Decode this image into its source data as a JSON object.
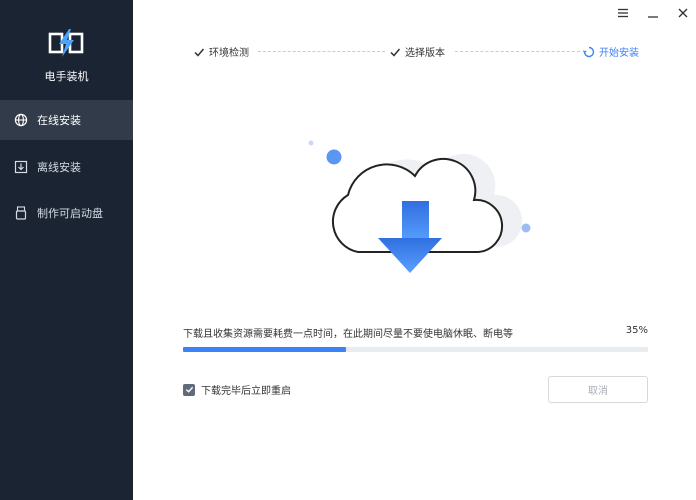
{
  "app": {
    "name": "电手装机"
  },
  "sidebar": {
    "items": [
      {
        "label": "在线安装",
        "active": true,
        "icon": "globe-icon"
      },
      {
        "label": "离线安装",
        "active": false,
        "icon": "download-box-icon"
      },
      {
        "label": "制作可启动盘",
        "active": false,
        "icon": "usb-drive-icon"
      }
    ]
  },
  "window": {
    "menu_icon": "menu-icon",
    "minimize_icon": "minimize-icon",
    "close_icon": "close-icon"
  },
  "steps": [
    {
      "label": "环境检测",
      "status": "done"
    },
    {
      "label": "选择版本",
      "status": "done"
    },
    {
      "label": "开始安装",
      "status": "current"
    }
  ],
  "progress": {
    "message": "下载且收集资源需要耗费一点时间，在此期间尽量不要使电脑休眠、断电等",
    "percent_label": "35%",
    "value": 0.35
  },
  "reboot_option": {
    "label": "下载完毕后立即重启",
    "checked": true
  },
  "cancel_button": {
    "label": "取消"
  },
  "colors": {
    "accent": "#3b82f6",
    "sidebar_bg": "#1a2433",
    "sidebar_active": "#313b49"
  }
}
